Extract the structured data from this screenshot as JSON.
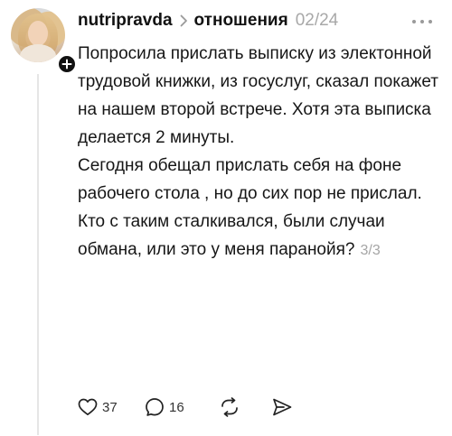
{
  "post": {
    "username": "nutripravda",
    "community": "отношения",
    "timestamp": "02/24",
    "body": [
      "Попросила прислать выписку из электонной трудовой книжки, из госуслуг, сказал покажет на нашем второй встрече. Хотя эта выписка делается 2 минуты.",
      "Сегодня обещал прислать себя на фоне рабочего стола , но до сих пор не прислал.",
      "Кто с таким сталкивался, были случаи обмана, или это у меня паранойя?"
    ],
    "page_counter": "3/3"
  },
  "actions": {
    "like_count": "37",
    "reply_count": "16"
  },
  "icons": {
    "follow": "plus-icon",
    "separator": "chevron-right-icon",
    "more": "more-horizontal-icon",
    "like": "heart-icon",
    "reply": "speech-bubble-icon",
    "repost": "repost-icon",
    "share": "send-icon"
  },
  "colors": {
    "text": "#161616",
    "muted": "#a8a8a8",
    "badge": "#111111",
    "thread_line": "#e6e6e6"
  }
}
